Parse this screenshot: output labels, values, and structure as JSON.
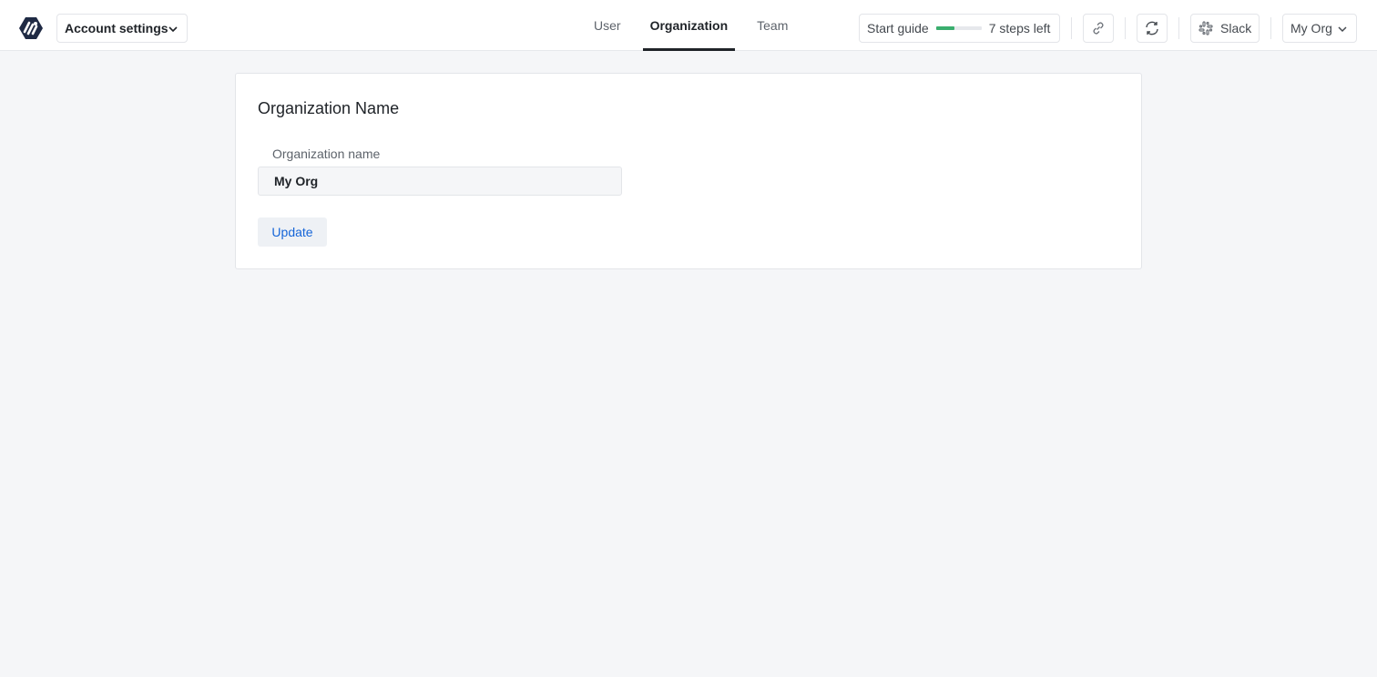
{
  "header": {
    "logo_icon": "brand-logo-icon",
    "account_menu_label": "Account settings",
    "tabs": [
      {
        "label": "User",
        "active": false
      },
      {
        "label": "Organization",
        "active": true
      },
      {
        "label": "Team",
        "active": false
      }
    ],
    "start_guide": {
      "label": "Start guide",
      "progress_percent": 40,
      "steps_left": "7 steps left",
      "progress_color": "#3aae6e"
    },
    "link_icon": "link-icon",
    "refresh_icon": "refresh-icon",
    "slack": {
      "icon": "slack-icon",
      "label": "Slack"
    },
    "org_menu_label": "My Org"
  },
  "main": {
    "section_title": "Organization Name",
    "org_name_field": {
      "label": "Organization name",
      "value": "My Org"
    },
    "update_button_label": "Update",
    "accent_color": "#1565d8"
  }
}
